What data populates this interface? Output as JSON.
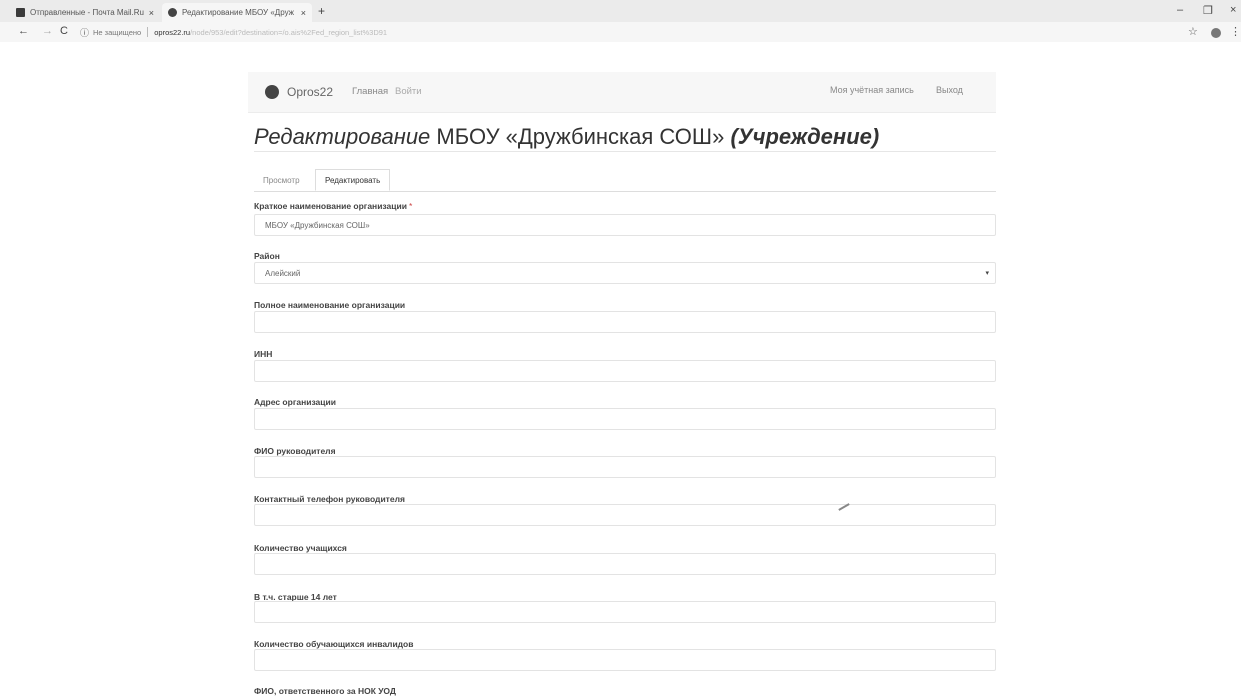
{
  "browser": {
    "tabs": [
      {
        "title": "Отправленные - Почта Mail.Ru",
        "close": "×"
      },
      {
        "title": "Редактирование МБОУ «Друж",
        "close": "×"
      }
    ],
    "new_tab": "+",
    "window_controls": {
      "minimize": "–",
      "maximize": "❐",
      "close": "×"
    },
    "nav": {
      "back": "←",
      "forward": "→",
      "reload": "C"
    },
    "address": {
      "info": "ⓘ",
      "security": "Не защищено",
      "host": "opros22.ru",
      "path": "/node/953/edit?destination=/o.ais%2Fed_region_list%3D91"
    },
    "star": "☆",
    "menu": "⋮"
  },
  "site": {
    "brand": "Opros22",
    "nav": {
      "home": "Главная",
      "login": "Войти",
      "account": "Моя учётная запись",
      "logout": "Выход"
    }
  },
  "page": {
    "title_prefix": "Редактирование",
    "title_name": "МБОУ «Дружбинская СОШ»",
    "title_suffix": "(Учреждение)",
    "tabs": {
      "view": "Просмотр",
      "edit": "Редактировать"
    }
  },
  "form": {
    "short_name": {
      "label": "Краткое наименование организации",
      "required_mark": "*",
      "value": "МБОУ «Дружбинская СОШ»"
    },
    "district": {
      "label": "Район",
      "value": "Алейский",
      "caret": "▾"
    },
    "full_name": {
      "label": "Полное наименование организации",
      "value": ""
    },
    "inn": {
      "label": "ИНН",
      "value": ""
    },
    "address": {
      "label": "Адрес организации",
      "value": ""
    },
    "head_name": {
      "label": "ФИО руководителя",
      "value": ""
    },
    "head_phone": {
      "label": "Контактный телефон руководителя",
      "value": ""
    },
    "students": {
      "label": "Количество учащихся",
      "value": ""
    },
    "over14": {
      "label": "В т.ч. старше 14 лет",
      "value": ""
    },
    "disabled": {
      "label": "Количество обучающихся инвалидов",
      "value": ""
    },
    "responsible": {
      "label": "ФИО, ответственного за НОК УОД"
    }
  }
}
